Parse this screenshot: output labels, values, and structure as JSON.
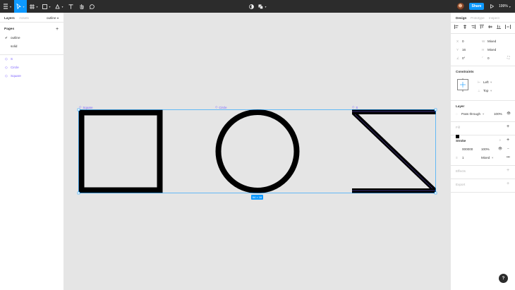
{
  "toolbar": {
    "share_label": "Share",
    "zoom_label": "199%"
  },
  "left_panel": {
    "tabs": [
      "Layers",
      "Assets",
      "outline"
    ],
    "pages_heading": "Pages",
    "pages": [
      {
        "label": "outline",
        "current": true
      },
      {
        "label": "solid",
        "current": false
      }
    ],
    "layers": [
      {
        "label": "S"
      },
      {
        "label": "Circle"
      },
      {
        "label": "Square"
      }
    ]
  },
  "canvas": {
    "frames": [
      {
        "label": "Square"
      },
      {
        "label": "Circle"
      },
      {
        "label": "S"
      }
    ],
    "selection_size": "64 × 16",
    "stroke_color": "#000000",
    "selection_color": "#0d99ff",
    "frame_label_color": "#7b61ff"
  },
  "right_panel": {
    "tabs": [
      "Design",
      "Prototype",
      "Inspect"
    ],
    "x_label": "X",
    "x_value": "0",
    "y_label": "Y",
    "y_value": "16",
    "w_value": "Mixed",
    "h_value": "Mixed",
    "rotation_value": "0°",
    "radius_value": "0",
    "constraints_heading": "Constraints",
    "constraint_h": "Left",
    "constraint_v": "Top",
    "layer_heading": "Layer",
    "blend_mode": "Pass through",
    "layer_opacity": "100%",
    "fill_heading": "Fill",
    "stroke_heading": "Stroke",
    "stroke_hex": "000000",
    "stroke_opacity": "100%",
    "stroke_weight": "1",
    "stroke_align": "Mixed",
    "effects_heading": "Effects",
    "export_heading": "Export"
  },
  "help_label": "?"
}
